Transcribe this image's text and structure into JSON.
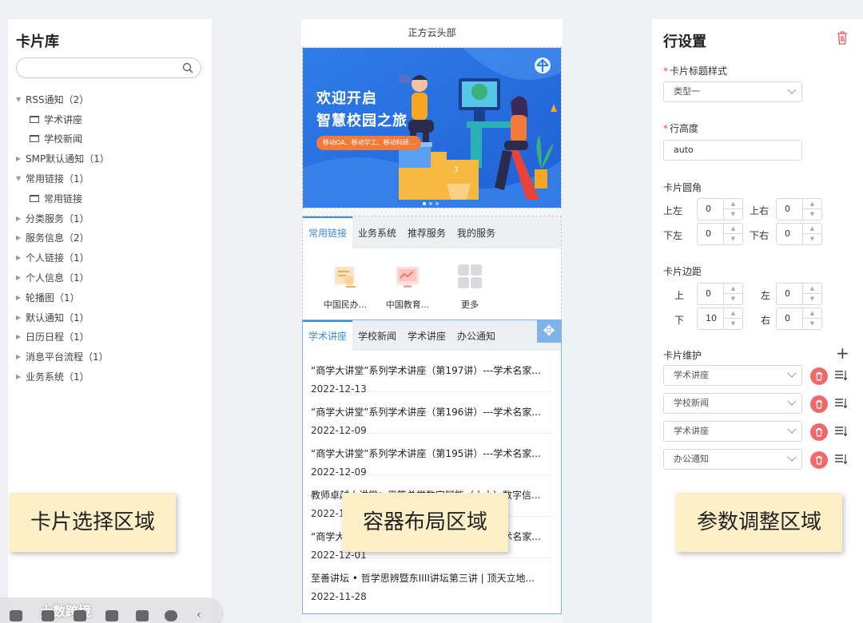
{
  "left": {
    "title": "卡片库",
    "search_placeholder": "",
    "tree": [
      {
        "label": "RSS通知（2）",
        "expanded": true,
        "child": false
      },
      {
        "label": "学术讲座",
        "child": true
      },
      {
        "label": "学校新闻",
        "child": true
      },
      {
        "label": "SMP默认通知（1）",
        "expanded": false,
        "child": false
      },
      {
        "label": "常用链接（1）",
        "expanded": true,
        "child": false
      },
      {
        "label": "常用链接",
        "child": true
      },
      {
        "label": "分类服务（1）",
        "expanded": false,
        "child": false
      },
      {
        "label": "服务信息（2）",
        "expanded": false,
        "child": false
      },
      {
        "label": "个人链接（1）",
        "expanded": false,
        "child": false
      },
      {
        "label": "个人信息（1）",
        "expanded": false,
        "child": false
      },
      {
        "label": "轮播图（1）",
        "expanded": false,
        "child": false
      },
      {
        "label": "默认通知（1）",
        "expanded": false,
        "child": false
      },
      {
        "label": "日历日程（1）",
        "expanded": false,
        "child": false
      },
      {
        "label": "消息平台流程（1）",
        "expanded": false,
        "child": false
      },
      {
        "label": "业务系统（1）",
        "expanded": false,
        "child": false
      }
    ]
  },
  "center": {
    "header": "正方云头部",
    "banner": {
      "line1": "欢迎开启",
      "line2": "智慧校园之旅",
      "tag": "移动OA、移动学工、移动科研..."
    },
    "links_tabs": [
      "常用链接",
      "业务系统",
      "推荐服务",
      "我的服务"
    ],
    "apps": [
      {
        "label": "中国民办...",
        "icon": "document-chart-icon"
      },
      {
        "label": "中国教育...",
        "icon": "screen-chart-icon"
      },
      {
        "label": "更多",
        "icon": "grid-more-icon"
      }
    ],
    "news_tabs": [
      "学术讲座",
      "学校新闻",
      "学术讲座",
      "办公通知"
    ],
    "news": [
      {
        "title": "“商学大讲堂”系列学术讲座（第197讲）---学术名家...",
        "date": "2022-12-13"
      },
      {
        "title": "“商学大讲堂”系列学术讲座（第196讲）---学术名家...",
        "date": "2022-12-09"
      },
      {
        "title": "“商学大讲堂”系列学术讲座（第195讲）---学术名家...",
        "date": "2022-12-09"
      },
      {
        "title": "教师卓越大讲堂：平等总学数字赋能（十大）数字信...",
        "date": "2022-12-07"
      },
      {
        "title": "“商学大讲堂”系列学术讲座（第194讲）---学术名家...",
        "date": "2022-12-01"
      },
      {
        "title": "至善讲坛 • 哲学思辨暨东IIII讲坛第三讲 | 顶天立地...",
        "date": "2022-11-28"
      }
    ]
  },
  "right": {
    "title": "行设置",
    "title_style_label": "卡片标题样式",
    "title_style_value": "类型一",
    "row_height_label": "行高度",
    "row_height_value": "auto",
    "radius_label": "卡片圆角",
    "radius": [
      {
        "label": "上左",
        "value": "0"
      },
      {
        "label": "上右",
        "value": "0"
      },
      {
        "label": "下左",
        "value": "0"
      },
      {
        "label": "下右",
        "value": "0"
      }
    ],
    "margin_label": "卡片边距",
    "margin": [
      {
        "label": "上",
        "value": "0"
      },
      {
        "label": "左",
        "value": "0"
      },
      {
        "label": "下",
        "value": "10"
      },
      {
        "label": "右",
        "value": "0"
      }
    ],
    "maint_label": "卡片维护",
    "maint": [
      "学术讲座",
      "学校新闻",
      "学术讲座",
      "办公通知"
    ]
  },
  "callouts": {
    "left": "卡片选择区域",
    "center": "容器布局区域",
    "right": "参数调整区域"
  },
  "watermark": "大数跨境",
  "colors": {
    "accent": "#3b8ce0",
    "danger": "#f06a6a",
    "callout_bg": "#fdf0c8"
  }
}
